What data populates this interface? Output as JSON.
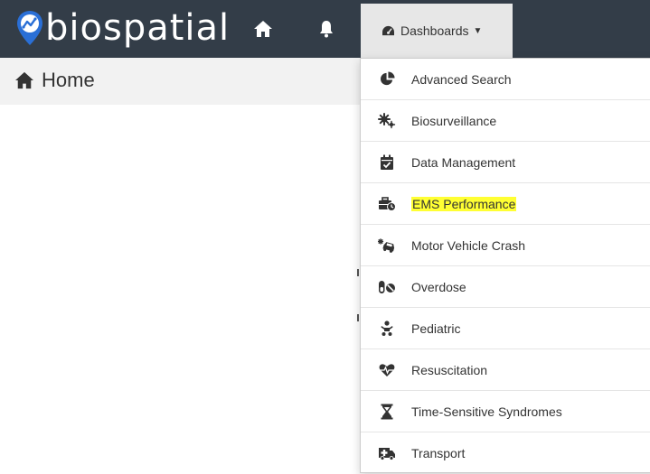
{
  "navbar": {
    "logo_text": "biospatial",
    "home_icon": "home-icon",
    "bell_icon": "bell-icon",
    "dashboards_label": "Dashboards",
    "dashboards_icon": "dashboard-gauge-icon",
    "bg_color": "#333d48"
  },
  "breadcrumb": {
    "home_label": "Home",
    "icon": "home-icon"
  },
  "dashboards_menu": {
    "items": [
      {
        "label": "Advanced Search",
        "icon": "pie-chart-icon"
      },
      {
        "label": "Biosurveillance",
        "icon": "cogs-icon"
      },
      {
        "label": "Data Management",
        "icon": "calendar-check-icon"
      },
      {
        "label": "EMS Performance",
        "icon": "toolbox-clock-icon",
        "highlighted": true
      },
      {
        "label": "Motor Vehicle Crash",
        "icon": "car-crash-icon"
      },
      {
        "label": "Overdose",
        "icon": "pills-icon"
      },
      {
        "label": "Pediatric",
        "icon": "baby-icon"
      },
      {
        "label": "Resuscitation",
        "icon": "heartbeat-icon"
      },
      {
        "label": "Time-Sensitive Syndromes",
        "icon": "hourglass-icon"
      },
      {
        "label": "Transport",
        "icon": "ambulance-icon"
      }
    ],
    "highlight_color": "#ffff33"
  }
}
